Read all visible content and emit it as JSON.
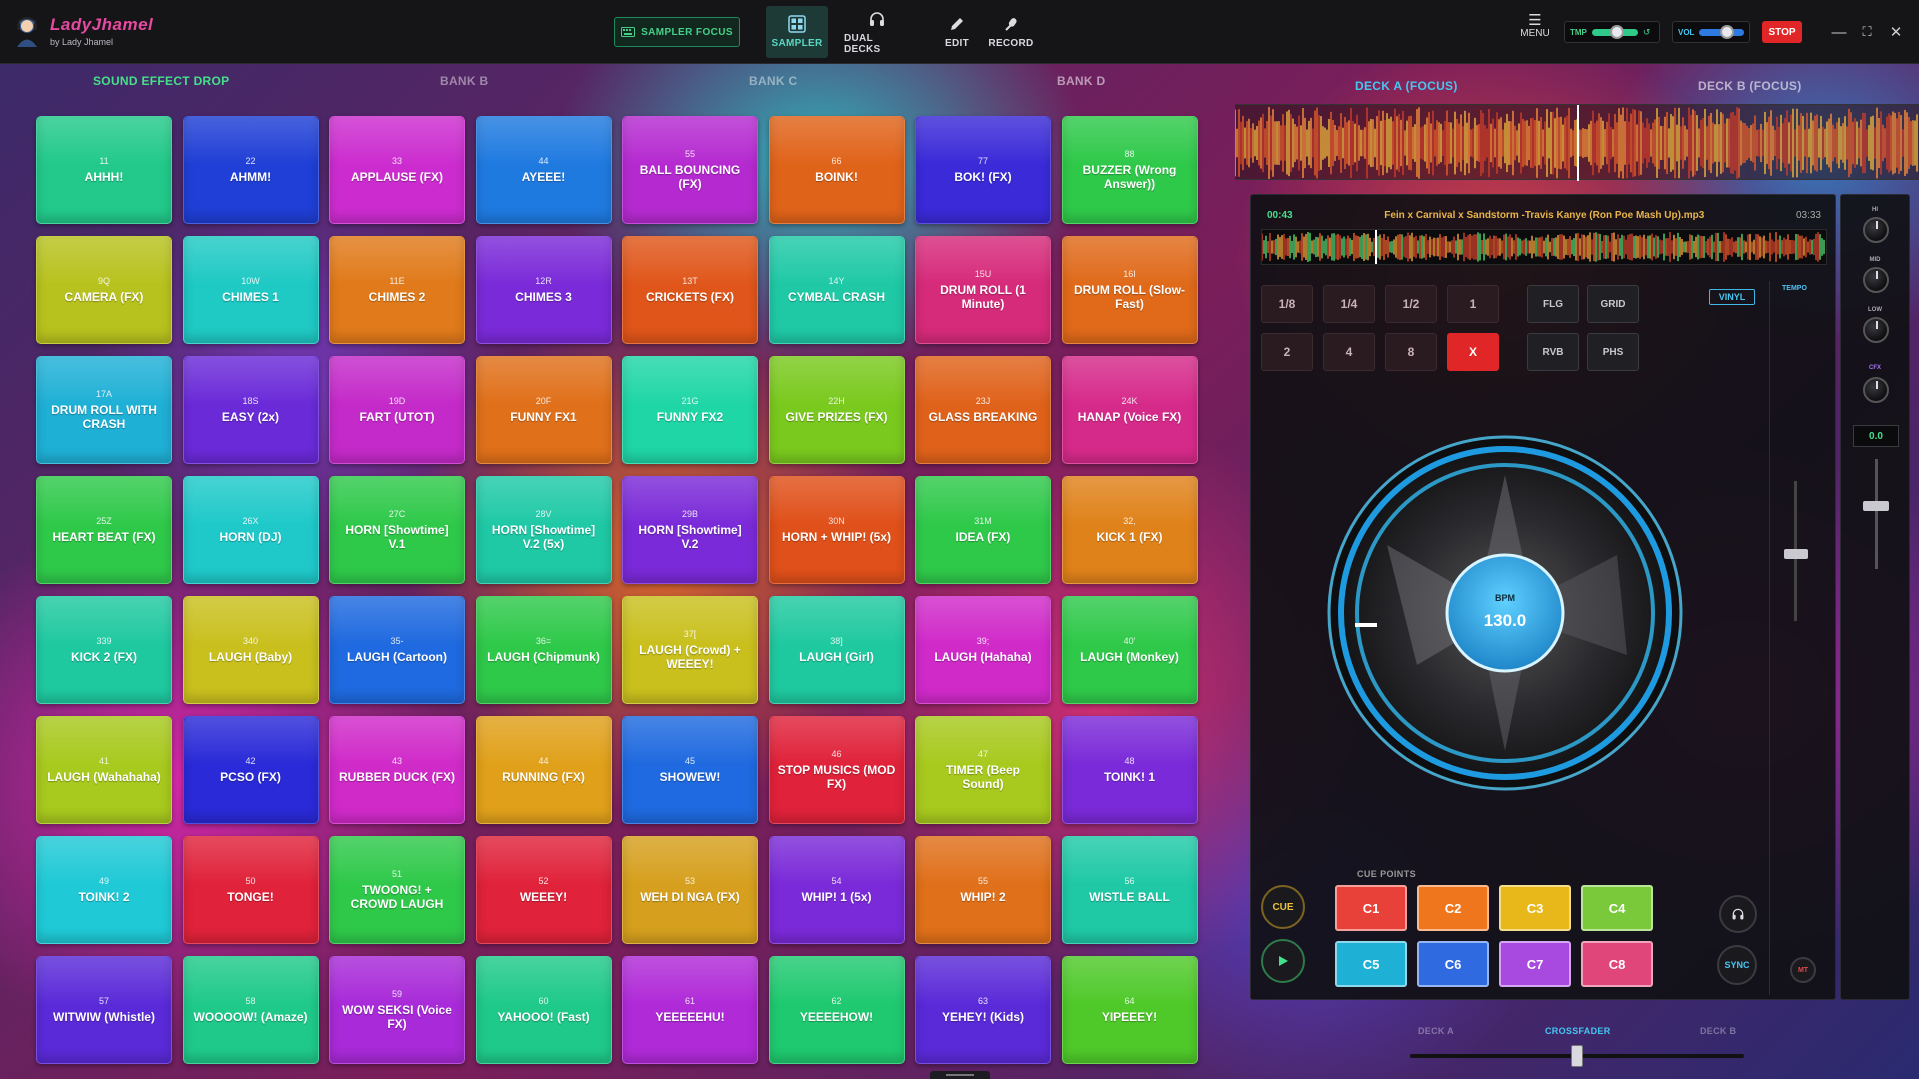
{
  "app": {
    "title": "LadyJhamel",
    "subtitle": "by Lady Jhamel"
  },
  "toolbar": {
    "sampler_focus": "SAMPLER FOCUS",
    "nav": [
      {
        "label": "SAMPLER",
        "icon": "grid-icon"
      },
      {
        "label": "DUAL DECKS",
        "icon": "headphones-icon"
      },
      {
        "label": "EDIT",
        "icon": "pencil-icon"
      },
      {
        "label": "RECORD",
        "icon": "mic-icon"
      }
    ],
    "menu": "MENU",
    "tmp_label": "TMP",
    "tmp_level": 0.55,
    "vol_label": "VOL",
    "vol_level": 0.6,
    "stop": "STOP"
  },
  "banks": [
    "SOUND EFFECT DROP",
    "BANK B",
    "BANK C",
    "BANK D"
  ],
  "colors": {
    "accent_green": "#45d08a",
    "accent_blue": "#46c7f2",
    "stop_red": "#e02626"
  },
  "pads": [
    {
      "key": "11",
      "name": "AHHH!",
      "color": "#22c98a"
    },
    {
      "key": "22",
      "name": "AHMM!",
      "color": "#1f3fd6"
    },
    {
      "key": "33",
      "name": "APPLAUSE (FX)",
      "color": "#cc2ccf"
    },
    {
      "key": "44",
      "name": "AYEEE!",
      "color": "#1f7ae0"
    },
    {
      "key": "55",
      "name": "BALL BOUNCING (FX)",
      "color": "#b52ad0"
    },
    {
      "key": "66",
      "name": "BOINK!",
      "color": "#e0631a"
    },
    {
      "key": "77",
      "name": "BOK! (FX)",
      "color": "#3a2ad8"
    },
    {
      "key": "88",
      "name": "BUZZER (Wrong Answer))",
      "color": "#2fc94a"
    },
    {
      "key": "9Q",
      "name": "CAMERA (FX)",
      "color": "#b8c21e"
    },
    {
      "key": "10W",
      "name": "CHIMES 1",
      "color": "#1fc9c4"
    },
    {
      "key": "11E",
      "name": "CHIMES 2",
      "color": "#e07a1a"
    },
    {
      "key": "12R",
      "name": "CHIMES 3",
      "color": "#7a2ad8"
    },
    {
      "key": "13T",
      "name": "CRICKETS (FX)",
      "color": "#e0561a"
    },
    {
      "key": "14Y",
      "name": "CYMBAL CRASH",
      "color": "#1fc9a6"
    },
    {
      "key": "15U",
      "name": "DRUM ROLL (1 Minute)",
      "color": "#d62a7a"
    },
    {
      "key": "16I",
      "name": "DRUM ROLL (Slow-Fast)",
      "color": "#e06a1a"
    },
    {
      "key": "17A",
      "name": "DRUM ROLL WITH CRASH",
      "color": "#1fb0d6"
    },
    {
      "key": "18S",
      "name": "EASY (2x)",
      "color": "#6a2ad8"
    },
    {
      "key": "19D",
      "name": "FART (UTOT)",
      "color": "#c42ac9"
    },
    {
      "key": "20F",
      "name": "FUNNY FX1",
      "color": "#e0701a"
    },
    {
      "key": "21G",
      "name": "FUNNY FX2",
      "color": "#1fd6a6"
    },
    {
      "key": "22H",
      "name": "GIVE PRIZES (FX)",
      "color": "#7ac91e"
    },
    {
      "key": "23J",
      "name": "GLASS BREAKING",
      "color": "#e0621a"
    },
    {
      "key": "24K",
      "name": "HANAP (Voice FX)",
      "color": "#d62a8a"
    },
    {
      "key": "25Z",
      "name": "HEART BEAT (FX)",
      "color": "#2fc94a"
    },
    {
      "key": "26X",
      "name": "HORN (DJ)",
      "color": "#1fc9c9"
    },
    {
      "key": "27C",
      "name": "HORN [Showtime] V.1",
      "color": "#2fc94a"
    },
    {
      "key": "28V",
      "name": "HORN [Showtime] V.2 (5x)",
      "color": "#1fc9a6"
    },
    {
      "key": "29B",
      "name": "HORN [Showtime] V.2",
      "color": "#7a2ad8"
    },
    {
      "key": "30N",
      "name": "HORN + WHIP! (5x)",
      "color": "#e0501a"
    },
    {
      "key": "31M",
      "name": "IDEA (FX)",
      "color": "#2fc94a"
    },
    {
      "key": "32,",
      "name": "KICK 1 (FX)",
      "color": "#e0821a"
    },
    {
      "key": "339",
      "name": "KICK 2 (FX)",
      "color": "#1fc9a0"
    },
    {
      "key": "340",
      "name": "LAUGH (Baby)",
      "color": "#c9c01e"
    },
    {
      "key": "35-",
      "name": "LAUGH (Cartoon)",
      "color": "#1f6ae0"
    },
    {
      "key": "36=",
      "name": "LAUGH (Chipmunk)",
      "color": "#2fc94a"
    },
    {
      "key": "37[",
      "name": "LAUGH (Crowd) + WEEEY!",
      "color": "#c9c01e"
    },
    {
      "key": "38]",
      "name": "LAUGH (Girl)",
      "color": "#1fc9a0"
    },
    {
      "key": "39;",
      "name": "LAUGH (Hahaha)",
      "color": "#d02ac9"
    },
    {
      "key": "40'",
      "name": "LAUGH (Monkey)",
      "color": "#2fc94a"
    },
    {
      "key": "41",
      "name": "LAUGH (Wahahaha)",
      "color": "#a8c91e"
    },
    {
      "key": "42",
      "name": "PCSO (FX)",
      "color": "#2a2ad8"
    },
    {
      "key": "43",
      "name": "RUBBER DUCK (FX)",
      "color": "#d02ac9"
    },
    {
      "key": "44",
      "name": "RUNNING (FX)",
      "color": "#e0a01a"
    },
    {
      "key": "45",
      "name": "SHOWEW!",
      "color": "#1f6ae0"
    },
    {
      "key": "46",
      "name": "STOP MUSICS (MOD FX)",
      "color": "#e0223a"
    },
    {
      "key": "47",
      "name": "TIMER (Beep Sound)",
      "color": "#a8c91e"
    },
    {
      "key": "48",
      "name": "TOINK! 1",
      "color": "#7a2ad8"
    },
    {
      "key": "49",
      "name": "TOINK! 2",
      "color": "#1fc9d6"
    },
    {
      "key": "50",
      "name": "TONGE!",
      "color": "#e0223a"
    },
    {
      "key": "51",
      "name": "TWOONG! + CROWD LAUGH",
      "color": "#2fc94a"
    },
    {
      "key": "52",
      "name": "WEEEY!",
      "color": "#e0223a"
    },
    {
      "key": "53",
      "name": "WEH DI NGA (FX)",
      "color": "#d6a01e"
    },
    {
      "key": "54",
      "name": "WHIP! 1 (5x)",
      "color": "#7a2ad8"
    },
    {
      "key": "55",
      "name": "WHIP! 2",
      "color": "#e0701a"
    },
    {
      "key": "56",
      "name": "WISTLE BALL",
      "color": "#1fc9a6"
    },
    {
      "key": "57",
      "name": "WITWIW (Whistle)",
      "color": "#5a2ad8"
    },
    {
      "key": "58",
      "name": "WOOOOW! (Amaze)",
      "color": "#1fc98a"
    },
    {
      "key": "59",
      "name": "WOW SEKSI (Voice FX)",
      "color": "#a82ad8"
    },
    {
      "key": "60",
      "name": "YAHOOO! (Fast)",
      "color": "#1fc98a"
    },
    {
      "key": "61",
      "name": "YEEEEEHU!",
      "color": "#b02ad8"
    },
    {
      "key": "62",
      "name": "YEEEEHOW!",
      "color": "#1fc970"
    },
    {
      "key": "63",
      "name": "YEHEY! (Kids)",
      "color": "#5a2ad8"
    },
    {
      "key": "64",
      "name": "YIPEEEY!",
      "color": "#4fc92a"
    }
  ],
  "decks": {
    "tab_a": "DECK A (FOCUS)",
    "tab_b": "DECK B (FOCUS)",
    "time_current": "00:43",
    "track_name": "Fein x Carnival x Sandstorm -Travis Kanye (Ron Poe Mash Up).mp3",
    "time_total": "03:33",
    "loop_buttons": [
      "1/8",
      "1/4",
      "1/2",
      "1",
      "2",
      "4",
      "8",
      "X"
    ],
    "fx_buttons": [
      "FLG",
      "GRID",
      "RVB",
      "PHS"
    ],
    "vinyl": "VINYL",
    "tempo_label": "TEMPO",
    "bpm_label": "BPM",
    "bpm_value": "130.0",
    "cue_points_label": "CUE POINTS",
    "cue_points": [
      {
        "label": "C1",
        "color": "#e8413a"
      },
      {
        "label": "C2",
        "color": "#f0761e"
      },
      {
        "label": "C3",
        "color": "#e8b81a"
      },
      {
        "label": "C4",
        "color": "#7ac93a"
      },
      {
        "label": "C5",
        "color": "#1fb0d6"
      },
      {
        "label": "C6",
        "color": "#2f6ae0"
      },
      {
        "label": "C7",
        "color": "#a84ae0"
      },
      {
        "label": "C8",
        "color": "#e0467a"
      }
    ],
    "cue_button": "CUE",
    "sync_button": "SYNC",
    "mt_button": "MT",
    "eq": {
      "hi": "HI",
      "mid": "MID",
      "low": "LOW",
      "cfx": "CFX",
      "gain_readout": "0.0"
    },
    "crossfader": {
      "label": "CROSSFADER",
      "left": "DECK A",
      "right": "DECK B",
      "position": 0.5
    }
  }
}
